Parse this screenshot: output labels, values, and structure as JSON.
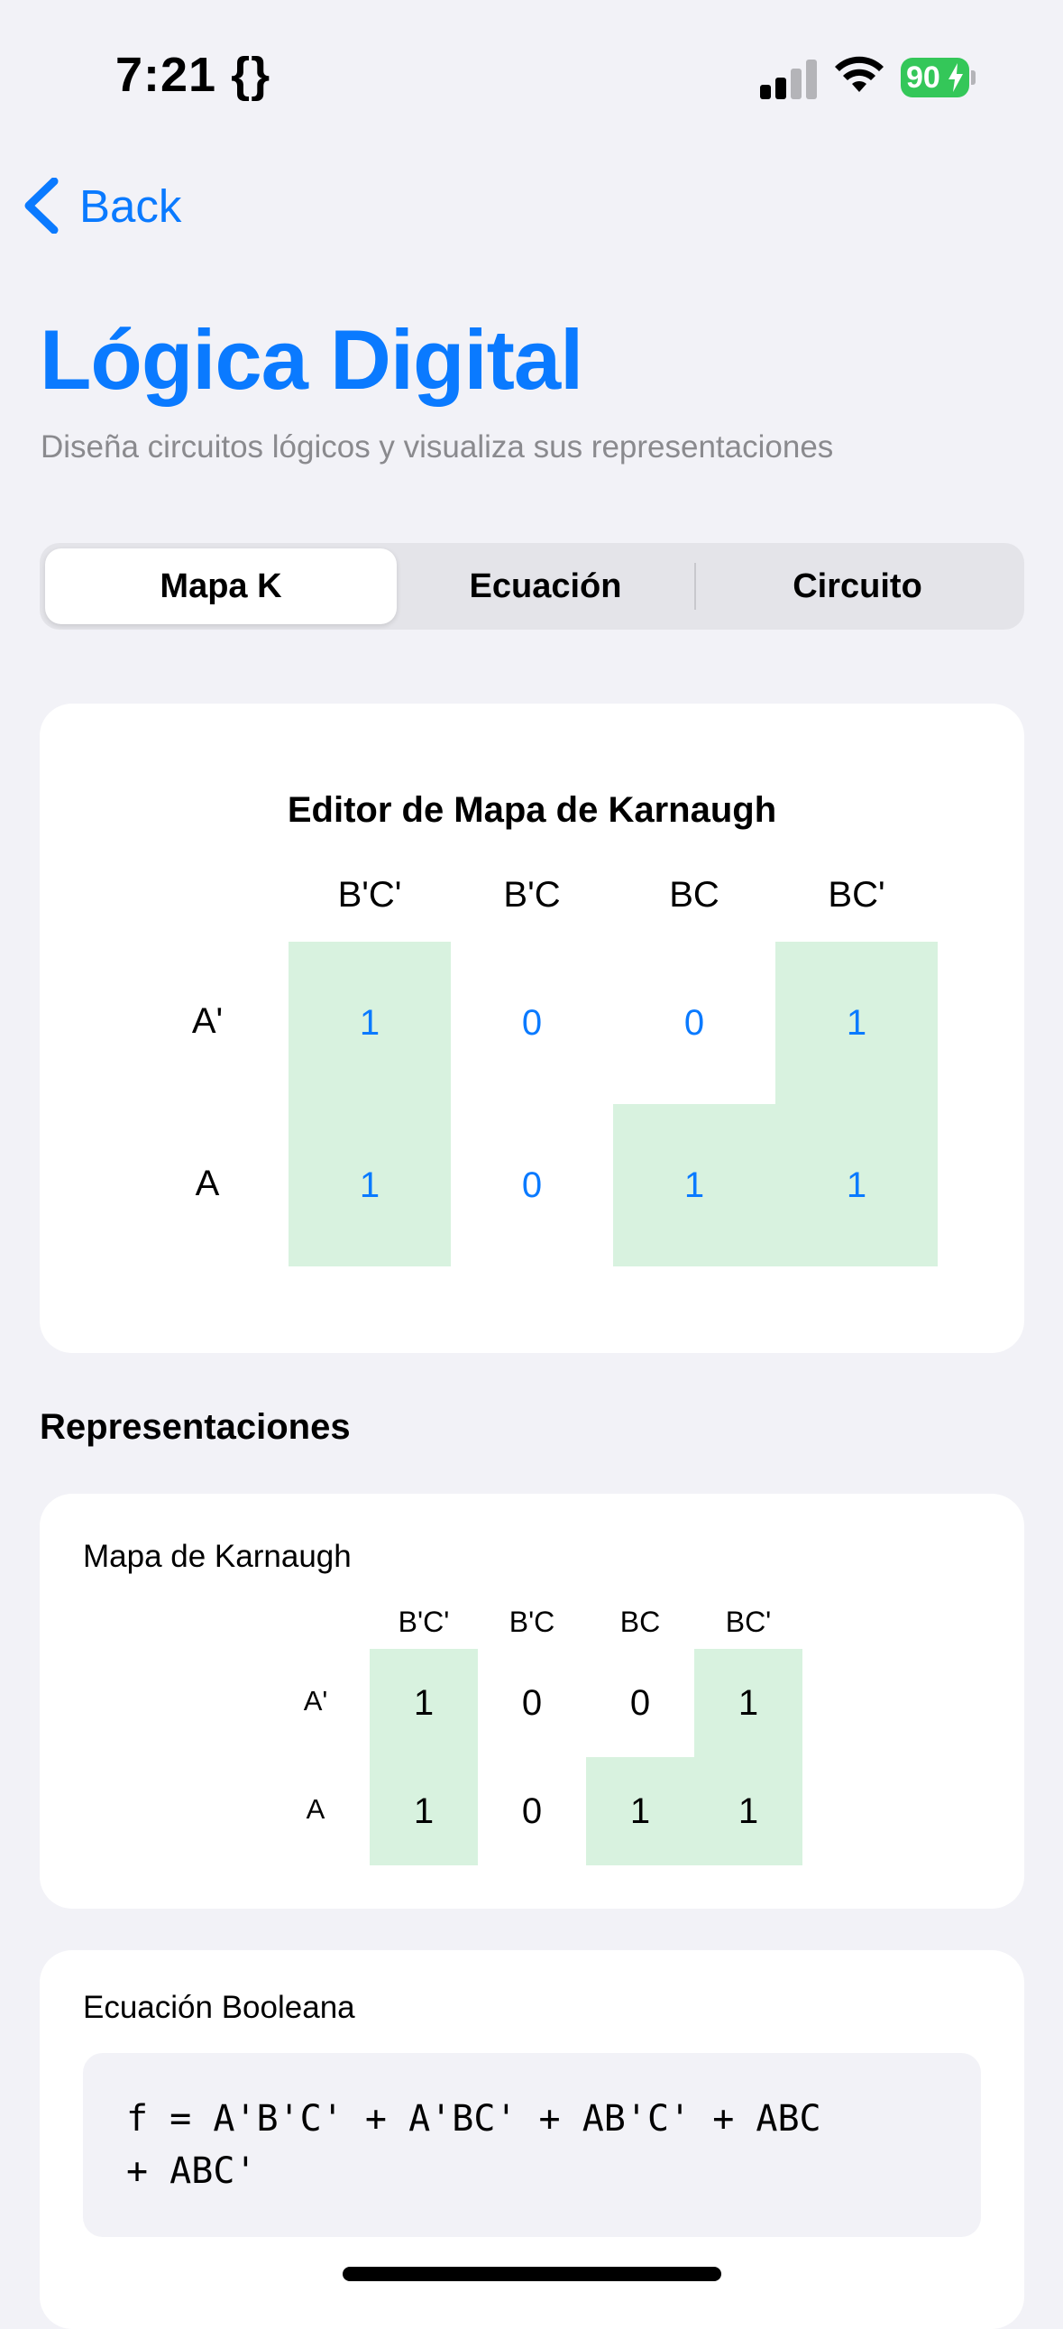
{
  "status_bar": {
    "time": "7:21",
    "app_glyph": "{}",
    "battery": "90",
    "battery_color": "#34c759"
  },
  "nav": {
    "back_label": "Back"
  },
  "header": {
    "title": "Lógica Digital",
    "subtitle": "Diseña circuitos lógicos y visualiza sus representaciones"
  },
  "tabs": [
    {
      "label": "Mapa K",
      "selected": true
    },
    {
      "label": "Ecuación",
      "selected": false
    },
    {
      "label": "Circuito",
      "selected": false
    }
  ],
  "editor": {
    "title": "Editor de Mapa de Karnaugh",
    "columns": [
      "B'C'",
      "B'C",
      "BC",
      "BC'"
    ],
    "rows": [
      {
        "label": "A'",
        "values": [
          "1",
          "0",
          "0",
          "1"
        ]
      },
      {
        "label": "A",
        "values": [
          "1",
          "0",
          "1",
          "1"
        ]
      }
    ]
  },
  "representations": {
    "section_title": "Representaciones",
    "kmap": {
      "label": "Mapa de Karnaugh",
      "columns": [
        "B'C'",
        "B'C",
        "BC",
        "BC'"
      ],
      "rows": [
        {
          "label": "A'",
          "values": [
            "1",
            "0",
            "0",
            "1"
          ]
        },
        {
          "label": "A",
          "values": [
            "1",
            "0",
            "1",
            "1"
          ]
        }
      ]
    },
    "equation": {
      "label": "Ecuación Booleana",
      "text": "f = A'B'C' + A'BC' + AB'C' + ABC\n+ ABC'"
    }
  },
  "colors": {
    "accent": "#0a7aff",
    "group_fill": "#d8f2df",
    "background": "#f2f2f7"
  }
}
